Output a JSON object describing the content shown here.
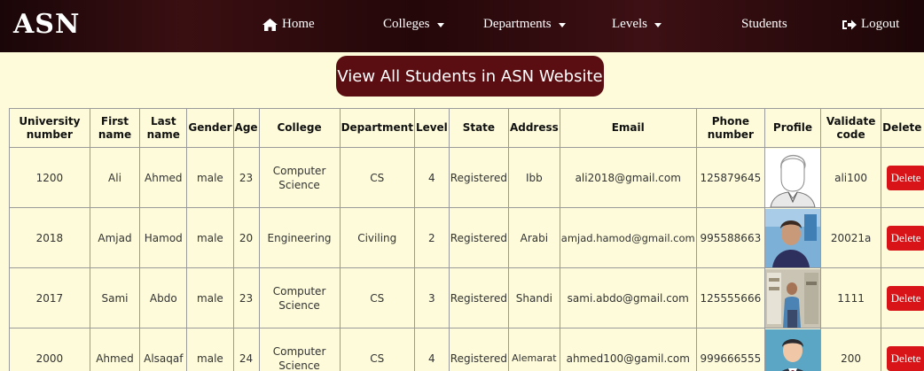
{
  "navbar": {
    "brand": "ASN",
    "home": "Home",
    "colleges": "Colleges",
    "departments": "Departments",
    "levels": "Levels",
    "students": "Students",
    "logout": "Logout"
  },
  "title_button": "View All Students in ASN Website",
  "table": {
    "headers": {
      "university_number": "University number",
      "first_name": "First name",
      "last_name": "Last name",
      "gender": "Gender",
      "age": "Age",
      "college": "College",
      "department": "Department",
      "level": "Level",
      "state": "State",
      "address": "Address",
      "email": "Email",
      "phone": "Phone number",
      "profile": "Profile",
      "validate_code": "Validate code",
      "delete": "Delete"
    },
    "rows": [
      {
        "university_number": "1200",
        "first_name": "Ali",
        "last_name": "Ahmed",
        "gender": "male",
        "age": "23",
        "college": "Computer Science",
        "department": "CS",
        "level": "4",
        "state": "Registered",
        "address": "Ibb",
        "email": "ali2018@gmail.com",
        "phone": "125879645",
        "profile": "sketch-avatar",
        "validate_code": "ali100",
        "delete": "Delete"
      },
      {
        "university_number": "2018",
        "first_name": "Amjad",
        "last_name": "Hamod",
        "gender": "male",
        "age": "20",
        "college": "Engineering",
        "department": "Civiling",
        "level": "2",
        "state": "Registered",
        "address": "Arabi",
        "email": "amjad.hamod@gmail.com",
        "phone": "995588663",
        "profile": "photo-man-blue",
        "validate_code": "20021a",
        "delete": "Delete"
      },
      {
        "university_number": "2017",
        "first_name": "Sami",
        "last_name": "Abdo",
        "gender": "male",
        "age": "23",
        "college": "Computer Science",
        "department": "CS",
        "level": "3",
        "state": "Registered",
        "address": "Shandi",
        "email": "sami.abdo@gmail.com",
        "phone": "125555666",
        "profile": "photo-man-indoor",
        "validate_code": "1111",
        "delete": "Delete"
      },
      {
        "university_number": "2000",
        "first_name": "Ahmed",
        "last_name": "Alsaqaf",
        "gender": "male",
        "age": "24",
        "college": "Computer Science",
        "department": "CS",
        "level": "4",
        "state": "Registered",
        "address": "Alemarat",
        "email": "ahmed100@gamil.com",
        "phone": "999666555",
        "profile": "avatar-man-suit",
        "validate_code": "200",
        "delete": "Delete"
      }
    ]
  },
  "colors": {
    "background": "#fdfbd9",
    "navbar": "#2a0a0c",
    "title_button": "#5b0e12",
    "delete_button": "#d81418"
  }
}
